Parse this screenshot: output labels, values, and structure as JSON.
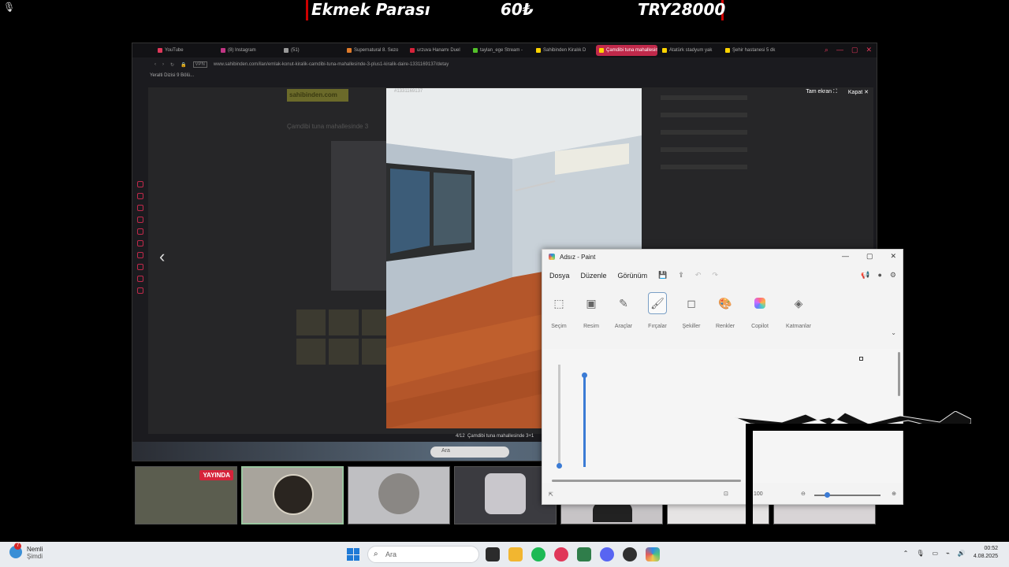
{
  "overlay": {
    "label": "Ekmek Parası",
    "price": "60₺",
    "total": "TRY28000"
  },
  "browser": {
    "tabs": [
      {
        "label": "YouTube",
        "color": "#e0385a",
        "active": false
      },
      {
        "label": "(8) Instagram",
        "color": "#c13584",
        "active": false
      },
      {
        "label": "(51)",
        "color": "#999999",
        "active": false
      },
      {
        "label": "Supernatural 8. Sezo",
        "color": "#e07b2a",
        "active": false
      },
      {
        "label": "urzuva Hanamı Duel",
        "color": "#d6233a",
        "active": false
      },
      {
        "label": "taylan_ege Stream -",
        "color": "#53c02a",
        "active": false
      },
      {
        "label": "Sahibinden Kiralık D",
        "color": "#ffd400",
        "active": false
      },
      {
        "label": "Çamdibi tuna mahallesind",
        "color": "#ffd400",
        "active": true
      },
      {
        "label": "Atatürk stadyum yak",
        "color": "#ffd400",
        "active": false
      },
      {
        "label": "Şehir hastanesi 5 dk",
        "color": "#ffd400",
        "active": false
      }
    ],
    "url": "www.sahibinden.com/ilan/emlak-konut-kiralik-camdibi-tuna-mahallesinde-3-plus1-kiralik-daire-1331169137/detay",
    "vpn": "VPN",
    "bookmark": "Yeralti Dizisi 9 Bölü...",
    "page": {
      "logo": "sahibinden.com",
      "title": "Çamdibi tuna mahallesinde 3",
      "photo_count_label": "Fotoğraf"
    },
    "lightbox": {
      "fullscreen_label": "Tam ekran",
      "close_label": "Kapat",
      "photo_id": "#1331169137",
      "counter": "4/12",
      "caption": "Çamdibi tuna mahallesinde 3+1"
    },
    "inner_taskbar_search": "Ara"
  },
  "stream_bar": {
    "live_label": "YAYINDA"
  },
  "paint": {
    "title": "Adsız - Paint",
    "menu": [
      "Dosya",
      "Düzenle",
      "Görünüm"
    ],
    "tools": [
      {
        "label": "Seçim",
        "icon": "selection-icon"
      },
      {
        "label": "Resim",
        "icon": "image-icon"
      },
      {
        "label": "Araçlar",
        "icon": "tools-icon"
      },
      {
        "label": "Fırçalar",
        "icon": "brush-icon"
      },
      {
        "label": "Şekiller",
        "icon": "shapes-icon"
      },
      {
        "label": "Renkler",
        "icon": "palette-icon"
      },
      {
        "label": "Copilot",
        "icon": "copilot-icon"
      },
      {
        "label": "Katmanlar",
        "icon": "layers-icon"
      }
    ],
    "selected_tool": "Fırçalar",
    "zoom": "100",
    "zoom_level_fraction": 0.15
  },
  "taskbar": {
    "weather_title": "Nemli",
    "weather_sub": "Şimdi",
    "notification_count": "7",
    "search_placeholder": "Ara",
    "time": "00:52",
    "date": "4.08.2025"
  }
}
